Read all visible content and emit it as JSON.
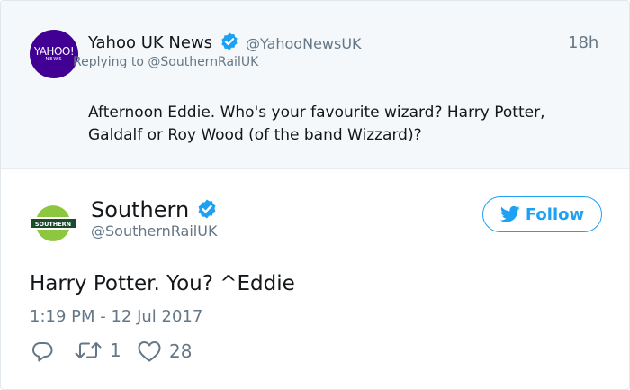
{
  "parent_tweet": {
    "avatar_wordmark": "YAHOO!",
    "avatar_sub": "NEWS",
    "name": "Yahoo UK News",
    "handle": "@YahooNewsUK",
    "time": "18h",
    "replying_to": "Replying to @SouthernRailUK",
    "text": "Afternoon Eddie. Who's your favourite wizard? Harry Potter, Galdalf or Roy Wood (of the band Wizzard)?"
  },
  "tweet": {
    "avatar_wordmark": "SOUTHERN",
    "name": "Southern",
    "handle": "@SouthernRailUK",
    "follow_label": "Follow",
    "text": "Harry Potter. You? ^Eddie",
    "timestamp": "1:19 PM - 12 Jul 2017",
    "retweet_count": "1",
    "like_count": "28"
  },
  "colors": {
    "accent": "#1da1f2",
    "yahoo_purple": "#410093",
    "southern_green": "#8dc63f",
    "southern_dark": "#1d4a2d",
    "muted": "#657786"
  },
  "icons": [
    "verified-badge-icon",
    "twitter-bird-icon",
    "reply-icon",
    "retweet-icon",
    "like-icon"
  ]
}
